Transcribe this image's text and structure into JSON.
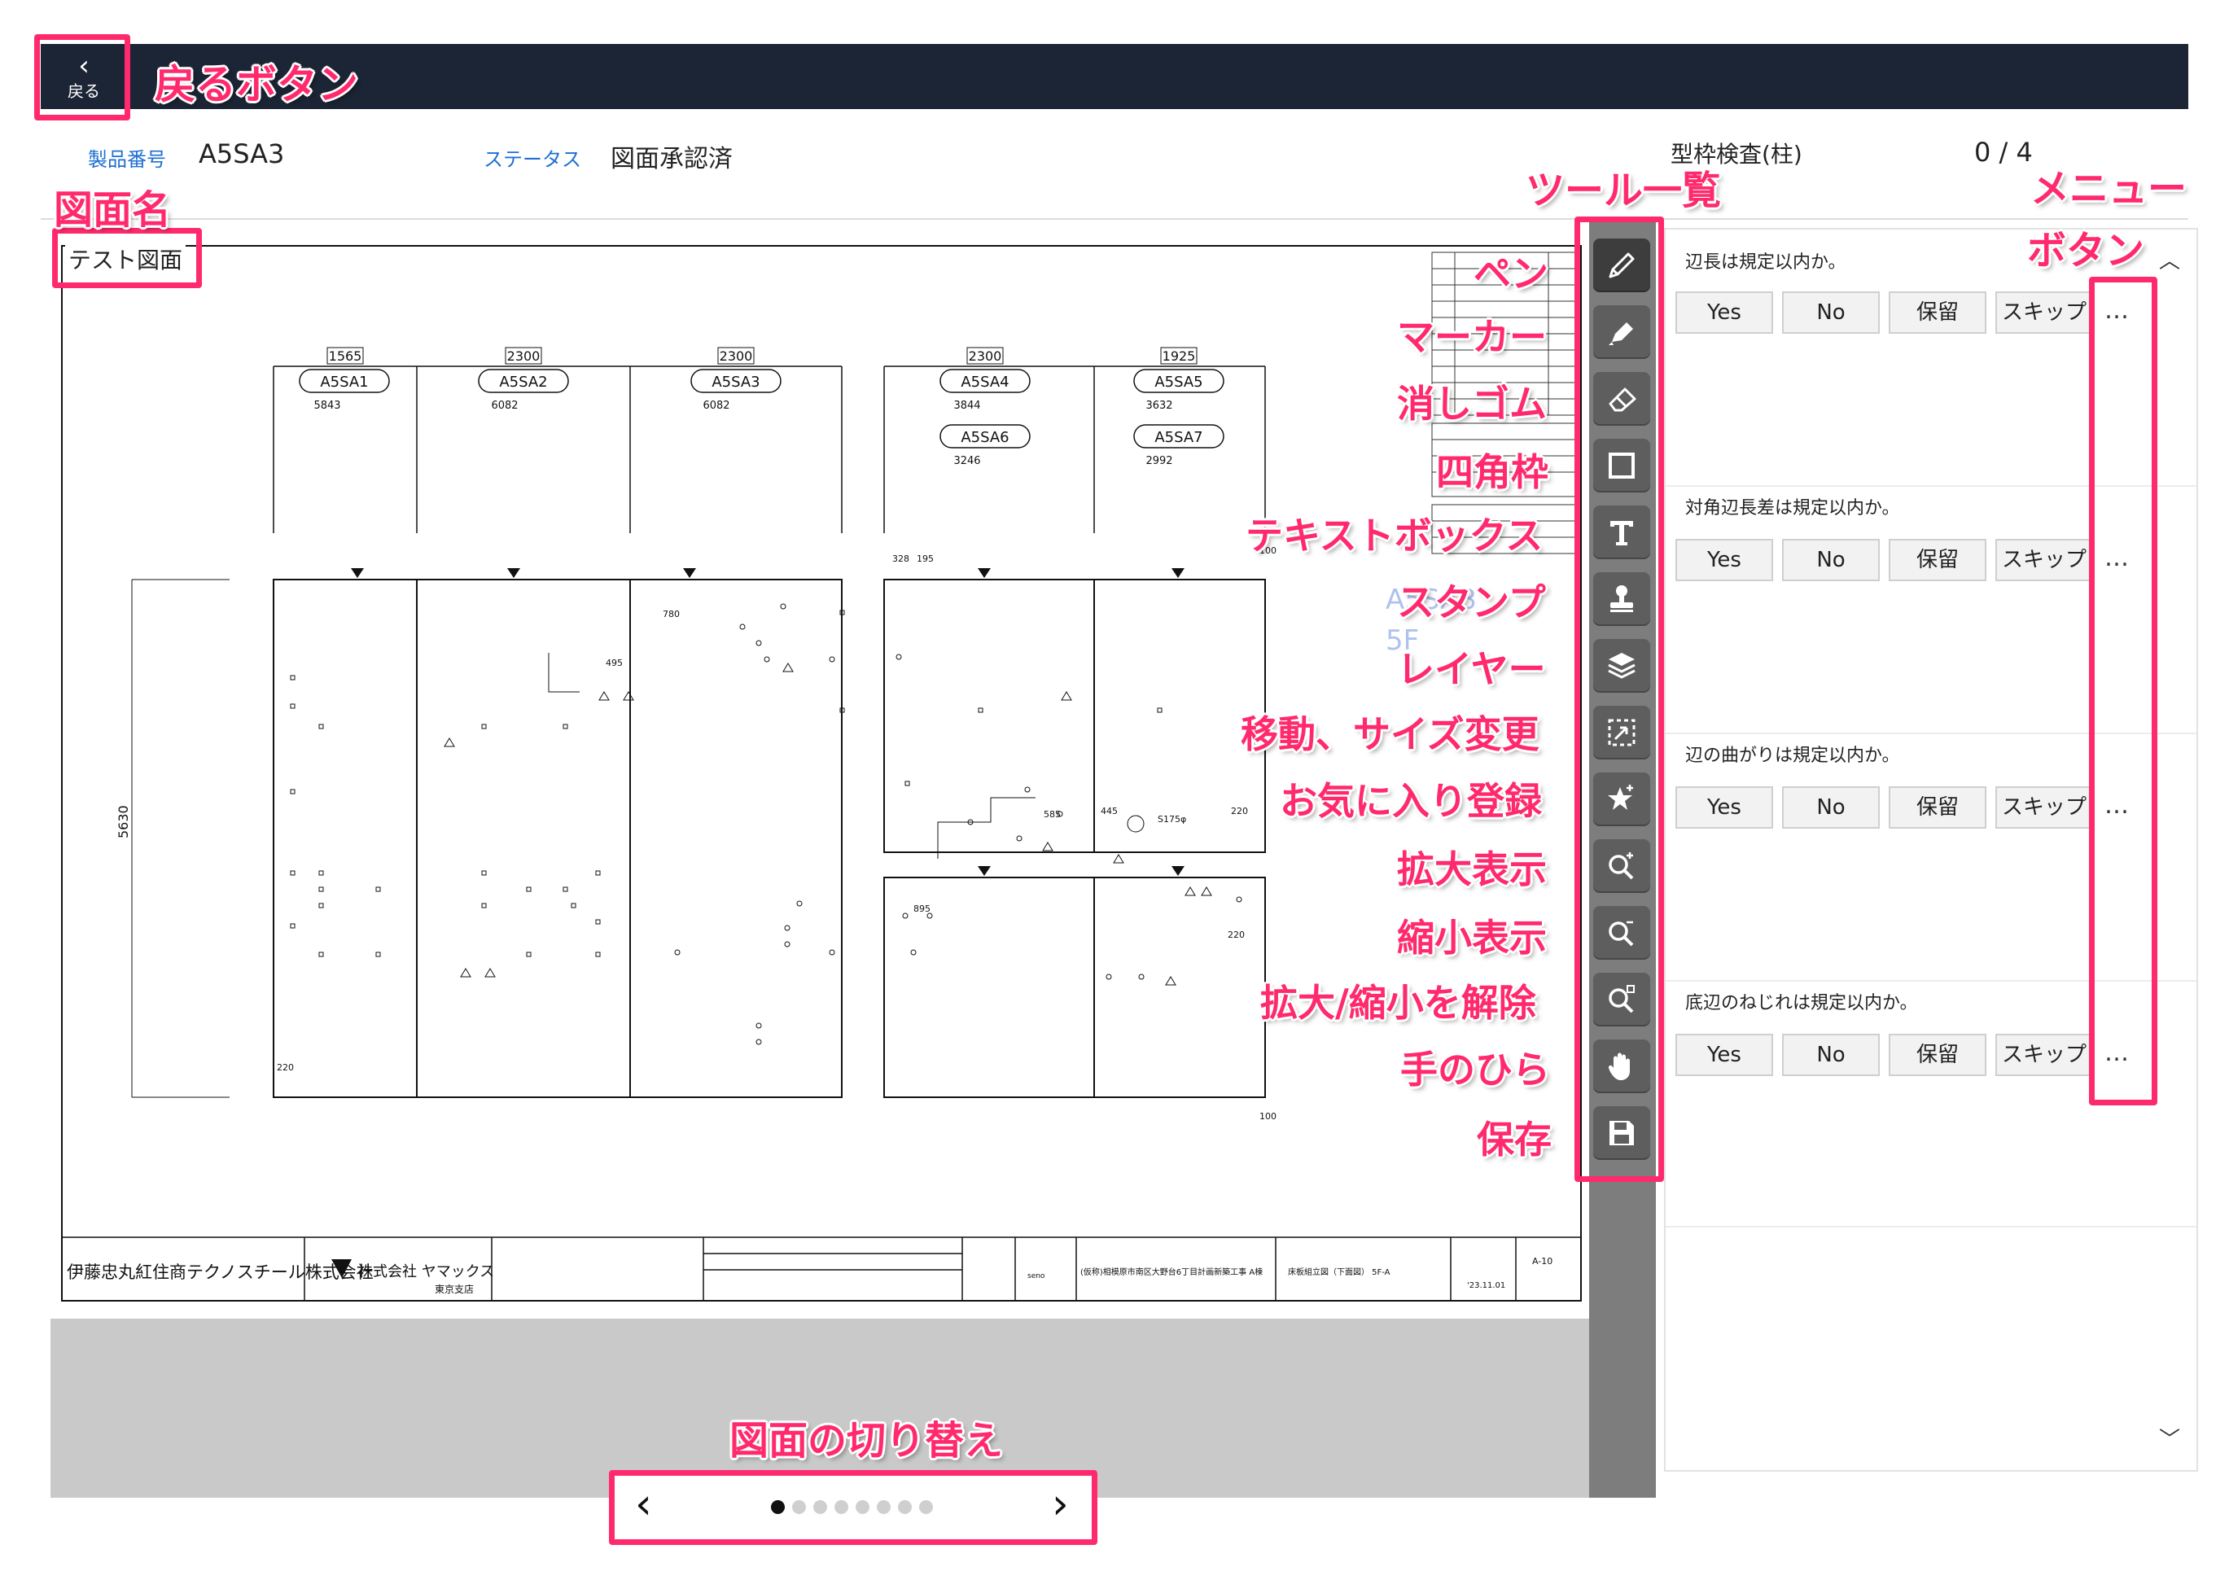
{
  "header": {
    "back_chevron": "‹",
    "back_label": "戻る"
  },
  "info": {
    "product_key": "製品番号",
    "product_value": "A5SA3",
    "status_key": "ステータス",
    "status_value": "図面承認済",
    "inspection_name": "型枠検査(柱)",
    "progress": "0 / 4"
  },
  "drawing": {
    "name": "テスト図面",
    "dims": [
      "1565",
      "2300",
      "2300",
      "2300",
      "1925"
    ],
    "pillars": [
      {
        "id": "A5SA1",
        "num": "5843"
      },
      {
        "id": "A5SA2",
        "num": "6082"
      },
      {
        "id": "A5SA3",
        "num": "6082"
      },
      {
        "id": "A5SA4",
        "num": "3844"
      },
      {
        "id": "A5SA5",
        "num": "3632"
      },
      {
        "id": "A5SA6",
        "num": "3246"
      },
      {
        "id": "A5SA7",
        "num": "2992"
      }
    ],
    "left_dim": "5630",
    "title_block": {
      "company": "伊藤忠丸紅住商テクノスチール株式会社",
      "logo": "株式会社 ヤマックス",
      "branch": "東京支店",
      "project": "(仮称)相模原市南区大野台6丁目計画新築工事 A棟",
      "drawing_title": "床板組立図（下面図） 5F-A",
      "drawing_no": "A-10",
      "date": "'23.11.01",
      "seno": "seno"
    }
  },
  "tools": [
    {
      "name": "pen",
      "label": "ペン"
    },
    {
      "name": "marker",
      "label": "マーカー"
    },
    {
      "name": "eraser",
      "label": "消しゴム"
    },
    {
      "name": "rectangle",
      "label": "四角枠"
    },
    {
      "name": "textbox",
      "label": "テキストボックス"
    },
    {
      "name": "stamp",
      "label": "スタンプ"
    },
    {
      "name": "layer",
      "label": "レイヤー"
    },
    {
      "name": "move-resize",
      "label": "移動、サイズ変更"
    },
    {
      "name": "favorite",
      "label": "お気に入り登録"
    },
    {
      "name": "zoom-in",
      "label": "拡大表示"
    },
    {
      "name": "zoom-out",
      "label": "縮小表示"
    },
    {
      "name": "zoom-reset",
      "label": "拡大/縮小を解除"
    },
    {
      "name": "hand",
      "label": "手のひら"
    },
    {
      "name": "save",
      "label": "保存"
    }
  ],
  "checklist": {
    "items": [
      {
        "question": "辺長は規定以内か。"
      },
      {
        "question": "対角辺長差は規定以内か。"
      },
      {
        "question": "辺の曲がりは規定以内か。"
      },
      {
        "question": "底辺のねじれは規定以内か。"
      }
    ],
    "answers": [
      "Yes",
      "No",
      "保留",
      "スキップ"
    ],
    "more": "…"
  },
  "pager": {
    "prev": "‹",
    "next": "›",
    "total_dots": 8,
    "current": 1
  },
  "annotations": {
    "back": "戻るボタン",
    "drawing_name": "図面名",
    "tool_list": "ツール一覧",
    "menu_line1": "メニュー",
    "menu_line2": "ボタン",
    "switch": "図面の切り替え"
  },
  "colors": {
    "accent": "#ff2a6d",
    "header_bg": "#1c2535",
    "link_blue": "#1f6fd1"
  }
}
